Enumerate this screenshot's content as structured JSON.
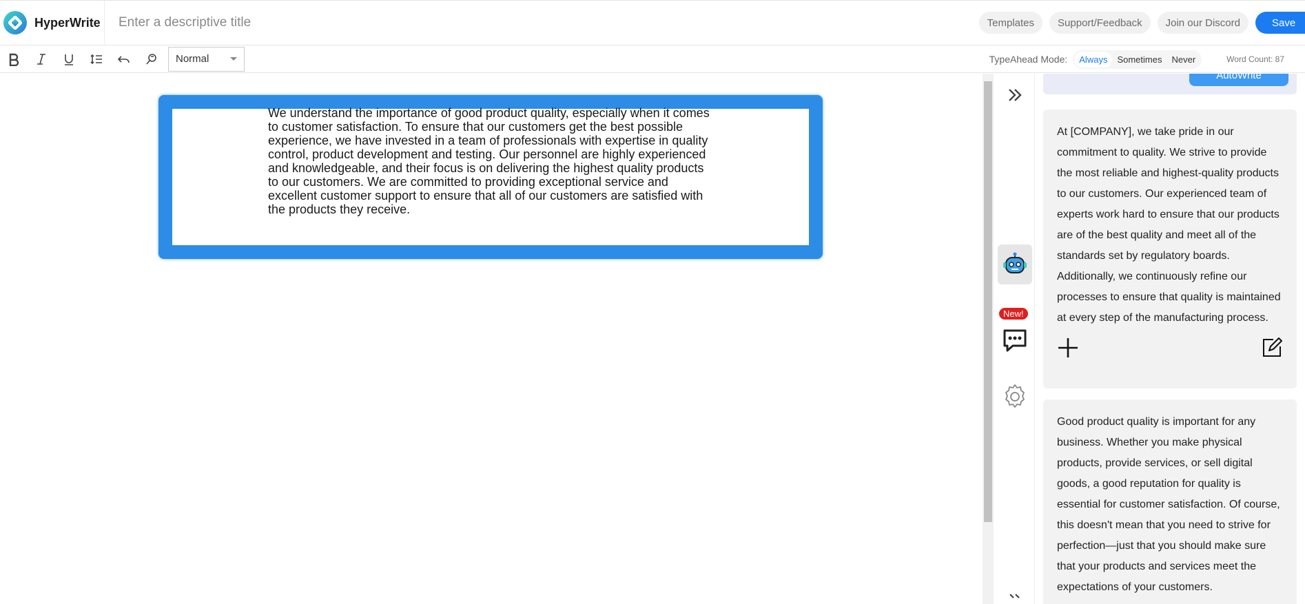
{
  "app": {
    "name": "HyperWrite",
    "title_placeholder": "Enter a descriptive title"
  },
  "header": {
    "templates": "Templates",
    "support": "Support/Feedback",
    "discord": "Join our Discord",
    "save": "Save"
  },
  "toolbar": {
    "style_value": "Normal",
    "typeahead_label": "TypeAhead Mode:",
    "modes": [
      "Always",
      "Sometimes",
      "Never"
    ],
    "active_mode": "Always",
    "word_count": "Word Count: 87"
  },
  "editor": {
    "text": "We understand the importance of good product quality, especially when it comes to customer satisfaction. To ensure that our customers get the best possible experience, we have invested in a team of professionals with expertise in quality control, product development and testing. Our personnel are highly experienced and knowledgeable, and their focus is on delivering the highest quality products to our customers. We are committed to providing exceptional service and excellent customer support to ensure that all of our customers are satisfied with the products they receive."
  },
  "rail": {
    "new_badge": "New!"
  },
  "panel": {
    "autowrite": "AutoWrite",
    "suggestions": [
      "At [COMPANY], we take pride in our commitment to quality. We strive to provide the most reliable and highest-quality products to our customers. Our experienced team of experts work hard to ensure that our products are of the best quality and meet all of the standards set by regulatory boards. Additionally, we continuously refine our processes to ensure that quality is maintained at every step of the manufacturing process.",
      "Good product quality is important for any business. Whether you make physical products, provide services, or sell digital goods, a good reputation for quality is essential for customer satisfaction. Of course, this doesn't mean that you need to strive for perfection—just that you should make sure that your products and services meet the expectations of your customers."
    ]
  },
  "colors": {
    "accent": "#1a7cf0",
    "highlight": "#2d8ce6",
    "badge": "#e01e1e"
  }
}
